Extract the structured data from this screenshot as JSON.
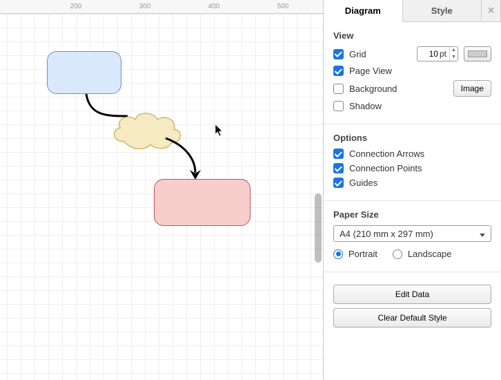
{
  "ruler": {
    "ticks": [
      200,
      300,
      400,
      500
    ]
  },
  "panel": {
    "tabs": {
      "diagram": "Diagram",
      "style": "Style"
    },
    "view": {
      "title": "View",
      "grid_label": "Grid",
      "grid_value": "10",
      "grid_unit": "pt",
      "pageview_label": "Page View",
      "background_label": "Background",
      "image_btn": "Image",
      "shadow_label": "Shadow"
    },
    "options": {
      "title": "Options",
      "conn_arrows": "Connection Arrows",
      "conn_points": "Connection Points",
      "guides": "Guides"
    },
    "paper": {
      "title": "Paper Size",
      "selected": "A4 (210 mm x 297 mm)",
      "portrait": "Portrait",
      "landscape": "Landscape"
    },
    "actions": {
      "edit_data": "Edit Data",
      "clear_style": "Clear Default Style"
    }
  },
  "shapes": {
    "blue_rect": "rounded-rect",
    "cloud": "cloud",
    "red_rect": "rounded-rect"
  }
}
